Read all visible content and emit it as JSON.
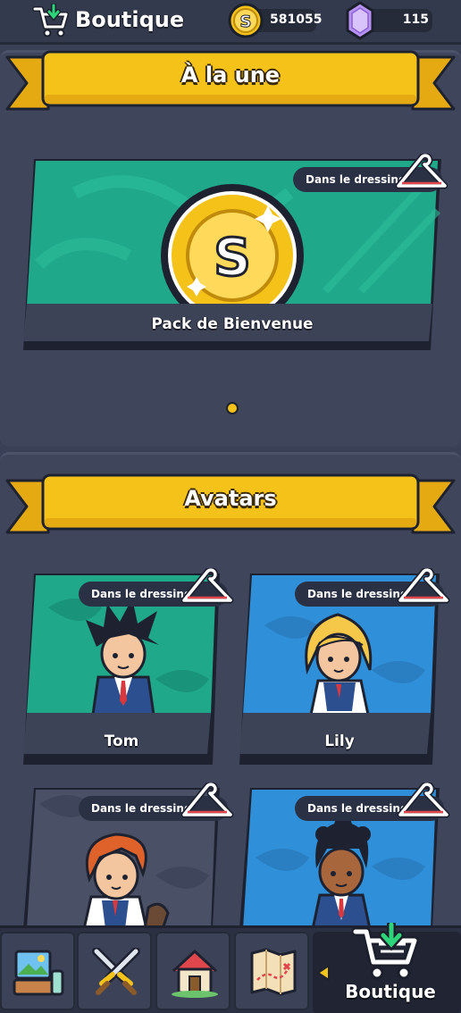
{
  "header": {
    "title": "Boutique",
    "coins": "581055",
    "gems": "115"
  },
  "sections": {
    "featured": {
      "title": "À la une",
      "card": {
        "label": "Pack de Bienvenue",
        "tag": "Dans le dressing"
      }
    },
    "avatars": {
      "title": "Avatars",
      "cards": [
        {
          "label": "Tom",
          "tag": "Dans le dressing"
        },
        {
          "label": "Lily",
          "tag": "Dans le dressing"
        },
        {
          "label": "",
          "tag": "Dans le dressing"
        },
        {
          "label": "",
          "tag": "Dans le dressing"
        }
      ]
    }
  },
  "nav": {
    "items": [
      "gallery-icon",
      "swords-icon",
      "home-icon",
      "map-icon"
    ],
    "active_label": "Boutique"
  },
  "colors": {
    "accent": "#f5c21a",
    "green_card": "#1fa88a",
    "blue_card": "#2f8fd8",
    "grey_card": "#4a5166"
  }
}
